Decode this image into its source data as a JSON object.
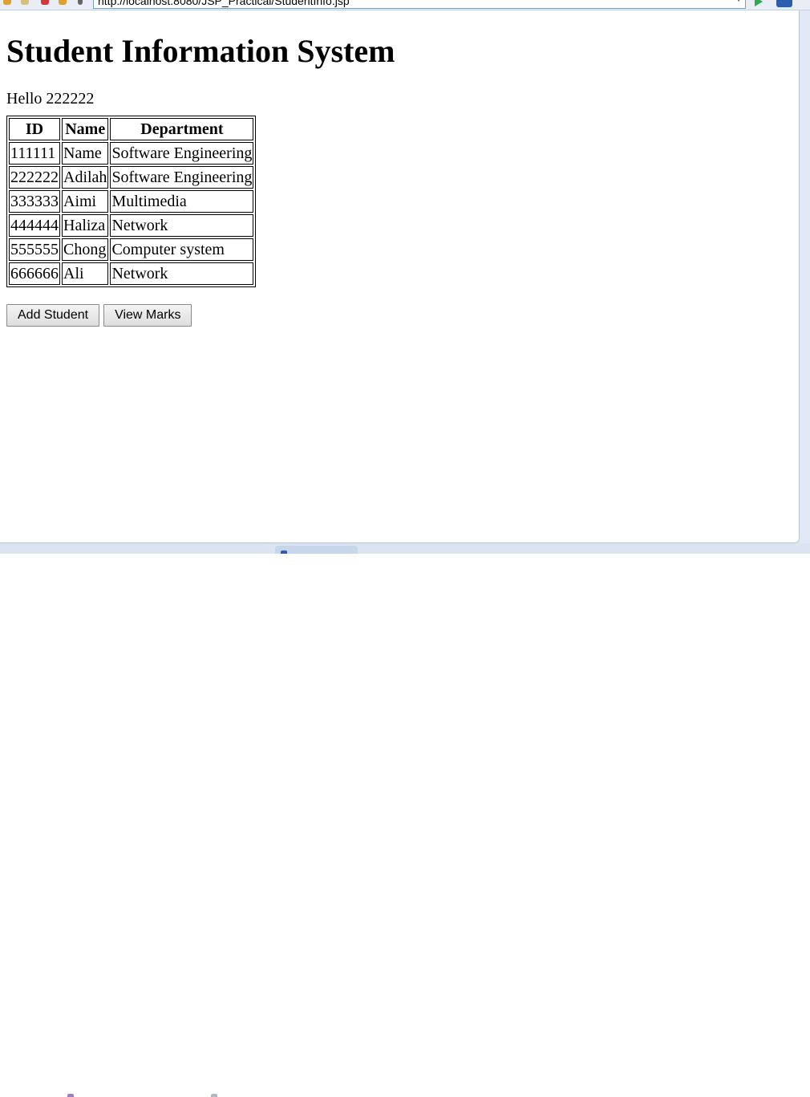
{
  "browser": {
    "address": "http://localhost:8080/JSP_Practical/StudentInfo.jsp"
  },
  "page": {
    "title": "Student Information System",
    "greeting": "Hello 222222"
  },
  "table": {
    "headers": [
      "ID",
      "Name",
      "Department"
    ],
    "rows": [
      [
        "111111",
        "Name",
        "Software Engineering"
      ],
      [
        "222222",
        "Adilah",
        "Software Engineering"
      ],
      [
        "333333",
        "Aimi",
        "Multimedia"
      ],
      [
        "444444",
        "Haliza",
        "Network"
      ],
      [
        "555555",
        "Chong",
        "Computer system"
      ],
      [
        "666666",
        "Ali",
        "Network"
      ]
    ]
  },
  "buttons": {
    "add_student": "Add Student",
    "view_marks": "View Marks"
  },
  "colors": {
    "go_icon": "#2fa84f",
    "extension_icon": "#2a5db0"
  }
}
